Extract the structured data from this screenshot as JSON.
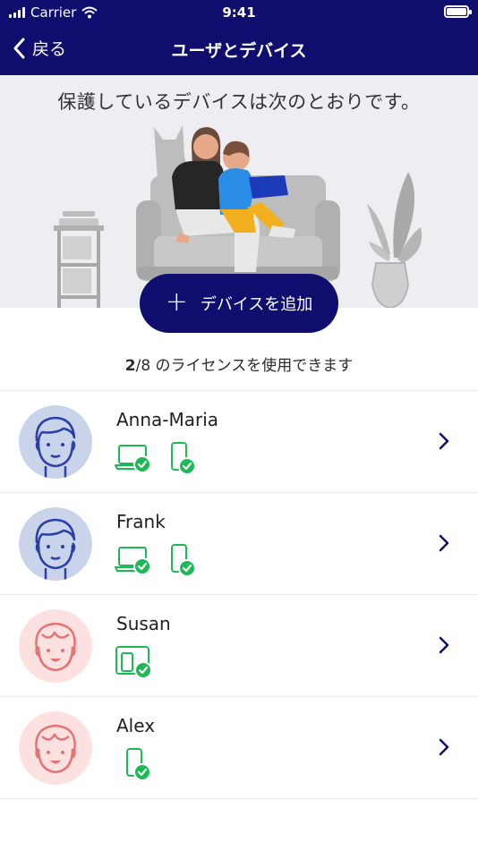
{
  "status_bar": {
    "carrier": "Carrier",
    "time": "9:41"
  },
  "nav": {
    "back_label": "戻る",
    "title": "ユーザとデバイス"
  },
  "hero": {
    "headline": "保護しているデバイスは次のとおりです。"
  },
  "add_device": {
    "label": "デバイスを追加"
  },
  "license": {
    "used": "2",
    "total": "/8",
    "suffix": " のライセンスを使用できます"
  },
  "users": [
    {
      "name": "Anna-Maria",
      "avatar": "male-face-icon",
      "devices": [
        "laptop-check-icon",
        "phone-check-icon"
      ]
    },
    {
      "name": "Frank",
      "avatar": "male-face-icon",
      "devices": [
        "laptop-check-icon",
        "phone-check-icon"
      ]
    },
    {
      "name": "Susan",
      "avatar": "child-face-icon",
      "devices": [
        "tablet-check-icon"
      ]
    },
    {
      "name": "Alex",
      "avatar": "child-face-icon",
      "devices": [
        "phone-check-icon"
      ]
    }
  ],
  "colors": {
    "brand": "#0f0e6e",
    "accent_green": "#1db954",
    "avatar_blue_bg": "#c9d4ea",
    "avatar_pink_bg": "#fde0e0"
  }
}
